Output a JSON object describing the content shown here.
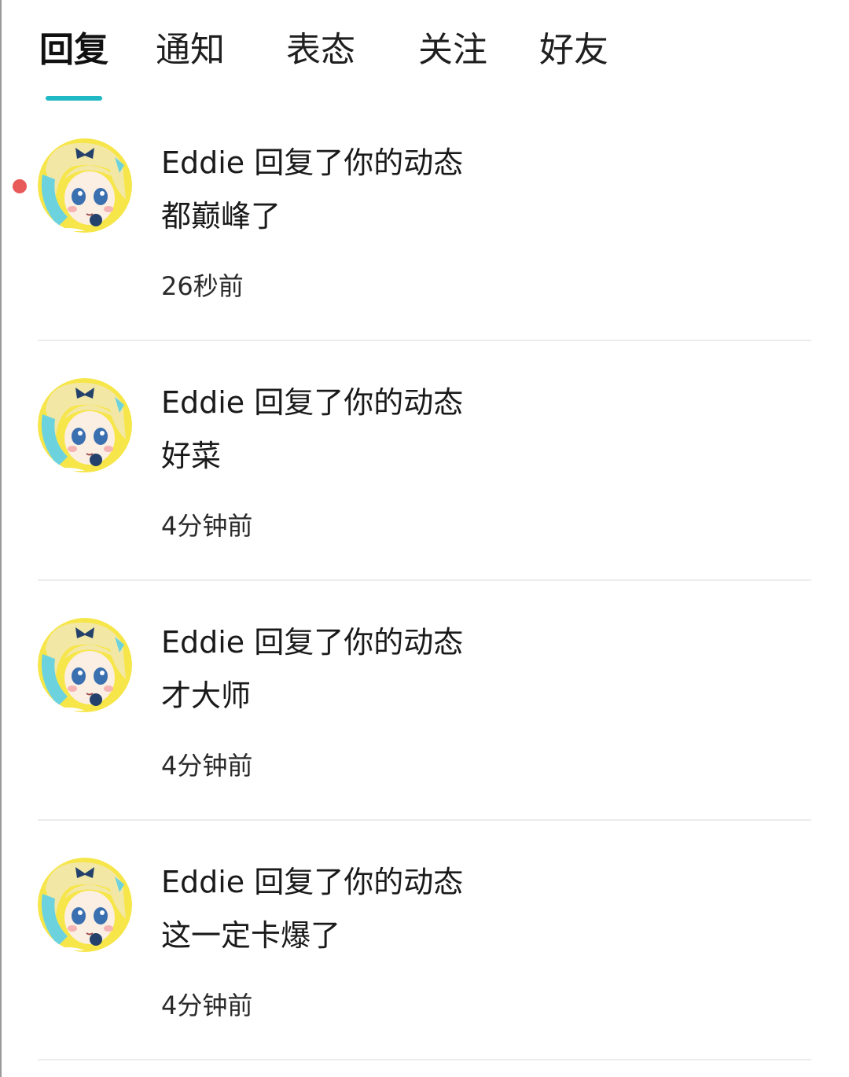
{
  "tabs": [
    {
      "label": "回复",
      "active": true
    },
    {
      "label": "通知",
      "active": false
    },
    {
      "label": "表态",
      "active": false
    },
    {
      "label": "关注",
      "active": false
    },
    {
      "label": "好友",
      "active": false
    }
  ],
  "colors": {
    "accent": "#1fb8c4",
    "unread_dot": "#e85a5a",
    "divider": "#ececec"
  },
  "notifications": [
    {
      "title": "Eddie 回复了你的动态",
      "content": "都巅峰了",
      "time": "26秒前",
      "unread": true,
      "avatar_icon": "anime-girl-avatar-icon"
    },
    {
      "title": "Eddie 回复了你的动态",
      "content": "好菜",
      "time": "4分钟前",
      "unread": false,
      "avatar_icon": "anime-girl-avatar-icon"
    },
    {
      "title": "Eddie 回复了你的动态",
      "content": "才大师",
      "time": "4分钟前",
      "unread": false,
      "avatar_icon": "anime-girl-avatar-icon"
    },
    {
      "title": "Eddie 回复了你的动态",
      "content": "这一定卡爆了",
      "time": "4分钟前",
      "unread": false,
      "avatar_icon": "anime-girl-avatar-icon"
    }
  ]
}
